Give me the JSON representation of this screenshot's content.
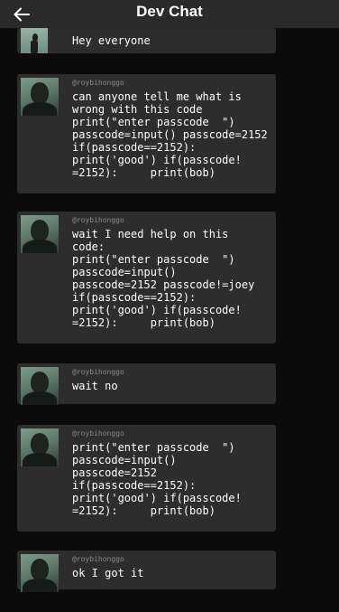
{
  "header": {
    "title": "Dev Chat",
    "back_icon": "arrow-left-icon"
  },
  "messages": [
    {
      "handle": "",
      "text": "Hey everyone"
    },
    {
      "handle": "@roybihonggo",
      "text": "can anyone tell me what is\nwrong with this code\nprint(\"enter passcode  \")\npasscode=input() passcode=2152\nif(passcode==2152):\nprint('good') if(passcode!\n=2152):     print(bob)"
    },
    {
      "handle": "@roybihonggo",
      "text": "wait I need help on this\ncode:\nprint(\"enter passcode  \")\npasscode=input()\npasscode=2152 passcode!=joey\nif(passcode==2152):\nprint('good') if(passcode!\n=2152):     print(bob)"
    },
    {
      "handle": "@roybihonggo",
      "text": "wait no"
    },
    {
      "handle": "@roybihonggo",
      "text": "print(\"enter passcode  \")\npasscode=input()\npasscode=2152\nif(passcode==2152):\nprint('good') if(passcode!\n=2152):     print(bob)"
    },
    {
      "handle": "@roybihonggo",
      "text": "ok I got it"
    }
  ]
}
